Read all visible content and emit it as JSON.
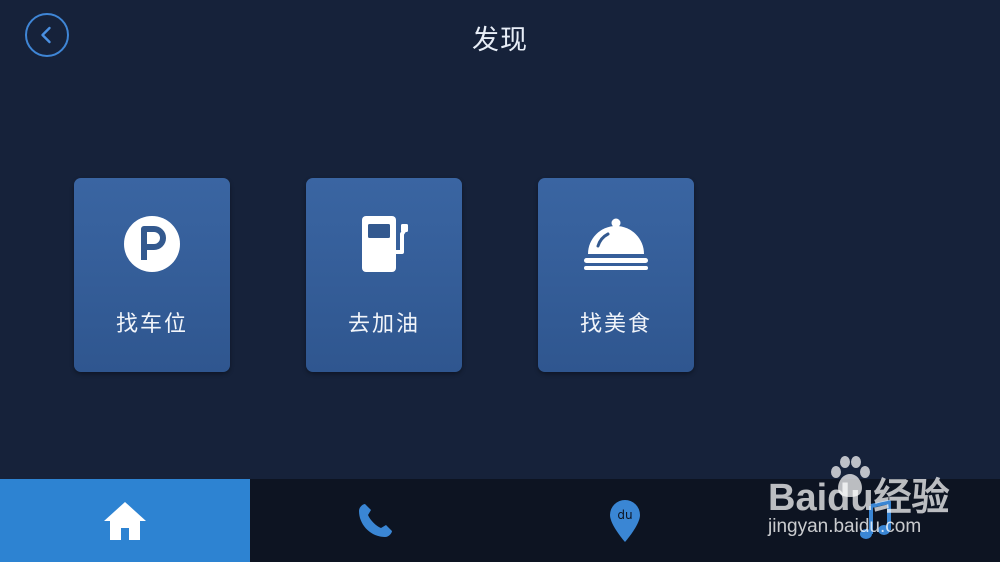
{
  "header": {
    "title": "发现",
    "back_icon": "chevron-left-icon"
  },
  "tiles": [
    {
      "label": "找车位",
      "icon": "parking-icon"
    },
    {
      "label": "去加油",
      "icon": "fuel-pump-icon"
    },
    {
      "label": "找美食",
      "icon": "food-cloche-icon"
    }
  ],
  "bottom_nav": [
    {
      "icon": "home-icon",
      "active": true
    },
    {
      "icon": "phone-icon",
      "active": false
    },
    {
      "icon": "map-pin-icon",
      "active": false
    },
    {
      "icon": "music-icon",
      "active": false
    }
  ],
  "watermark": {
    "brand": "Baidu经验",
    "url": "jingyan.baidu.com"
  },
  "colors": {
    "background": "#16223a",
    "tile": "#3a65a2",
    "accent": "#2d83d2",
    "bottom_bar": "#0d1422"
  }
}
